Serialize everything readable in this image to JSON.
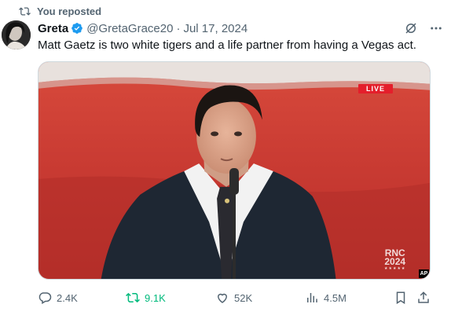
{
  "repost_context": {
    "label": "You reposted"
  },
  "author": {
    "name": "Greta",
    "handle": "@GretaGrace20",
    "date": "Jul 17, 2024",
    "verified": true
  },
  "tweet": {
    "text": "Matt Gaetz is two white tigers and a life partner from having a Vegas act."
  },
  "media": {
    "live_label": "LIVE",
    "logo_line1": "RNC",
    "logo_line2": "2024",
    "logo_stars": "★★★★★",
    "credit": "AP"
  },
  "actions": {
    "replies": "2.4K",
    "reposts": "9.1K",
    "likes": "52K",
    "views": "4.5M"
  },
  "icons": [
    "repost-icon",
    "verified-badge-icon",
    "grok-icon",
    "more-icon",
    "reply-icon",
    "like-icon",
    "views-icon",
    "bookmark-icon",
    "share-icon"
  ],
  "colors": {
    "accent_blue": "#1d9bf0",
    "repost_green": "#00ba7c",
    "muted": "#536471",
    "live_red": "#e41e2b"
  }
}
